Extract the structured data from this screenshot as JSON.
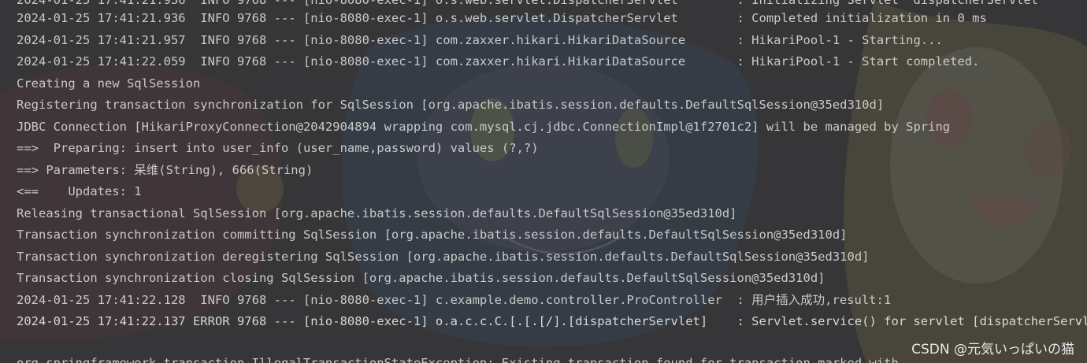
{
  "console": {
    "lines": [
      {
        "text": "2024-01-25 17:41:21.936  INFO 9768 --- [nio-8080-exec-1] o.s.web.servlet.DispatcherServlet        : Initializing Servlet 'dispatcherServlet'"
      },
      {
        "text": "2024-01-25 17:41:21.936  INFO 9768 --- [nio-8080-exec-1] o.s.web.servlet.DispatcherServlet        : Completed initialization in 0 ms"
      },
      {
        "text": "2024-01-25 17:41:21.957  INFO 9768 --- [nio-8080-exec-1] com.zaxxer.hikari.HikariDataSource       : HikariPool-1 - Starting..."
      },
      {
        "text": "2024-01-25 17:41:22.059  INFO 9768 --- [nio-8080-exec-1] com.zaxxer.hikari.HikariDataSource       : HikariPool-1 - Start completed."
      },
      {
        "text": "Creating a new SqlSession"
      },
      {
        "text": "Registering transaction synchronization for SqlSession [org.apache.ibatis.session.defaults.DefaultSqlSession@35ed310d]"
      },
      {
        "text": "JDBC Connection [HikariProxyConnection@2042904894 wrapping com.mysql.cj.jdbc.ConnectionImpl@1f2701c2] will be managed by Spring"
      },
      {
        "text": "==>  Preparing: insert into user_info (user_name,password) values (?,?)"
      },
      {
        "text": "==> Parameters: 呆维(String), 666(String)"
      },
      {
        "text": "<==    Updates: 1"
      },
      {
        "text": "Releasing transactional SqlSession [org.apache.ibatis.session.defaults.DefaultSqlSession@35ed310d]"
      },
      {
        "text": "Transaction synchronization committing SqlSession [org.apache.ibatis.session.defaults.DefaultSqlSession@35ed310d]"
      },
      {
        "text": "Transaction synchronization deregistering SqlSession [org.apache.ibatis.session.defaults.DefaultSqlSession@35ed310d]"
      },
      {
        "text": "Transaction synchronization closing SqlSession [org.apache.ibatis.session.defaults.DefaultSqlSession@35ed310d]"
      },
      {
        "text": "2024-01-25 17:41:22.128  INFO 9768 --- [nio-8080-exec-1] c.example.demo.controller.ProController  : 用户插入成功,result:1"
      },
      {
        "text": "2024-01-25 17:41:22.137 ERROR 9768 --- [nio-8080-exec-1] o.a.c.c.C.[.[.[/].[dispatcherServlet]    : Servlet.service() for servlet [dispatcherServlet]"
      },
      {
        "text": ""
      },
      {
        "text": "org.springframework.transaction.IllegalTransactionStateException: Existing transaction found for transaction marked with"
      }
    ]
  },
  "watermark": "CSDN @元気いっぱいの猫",
  "colors": {
    "background": "#3a3b3d",
    "text": "#c9c9c9"
  }
}
